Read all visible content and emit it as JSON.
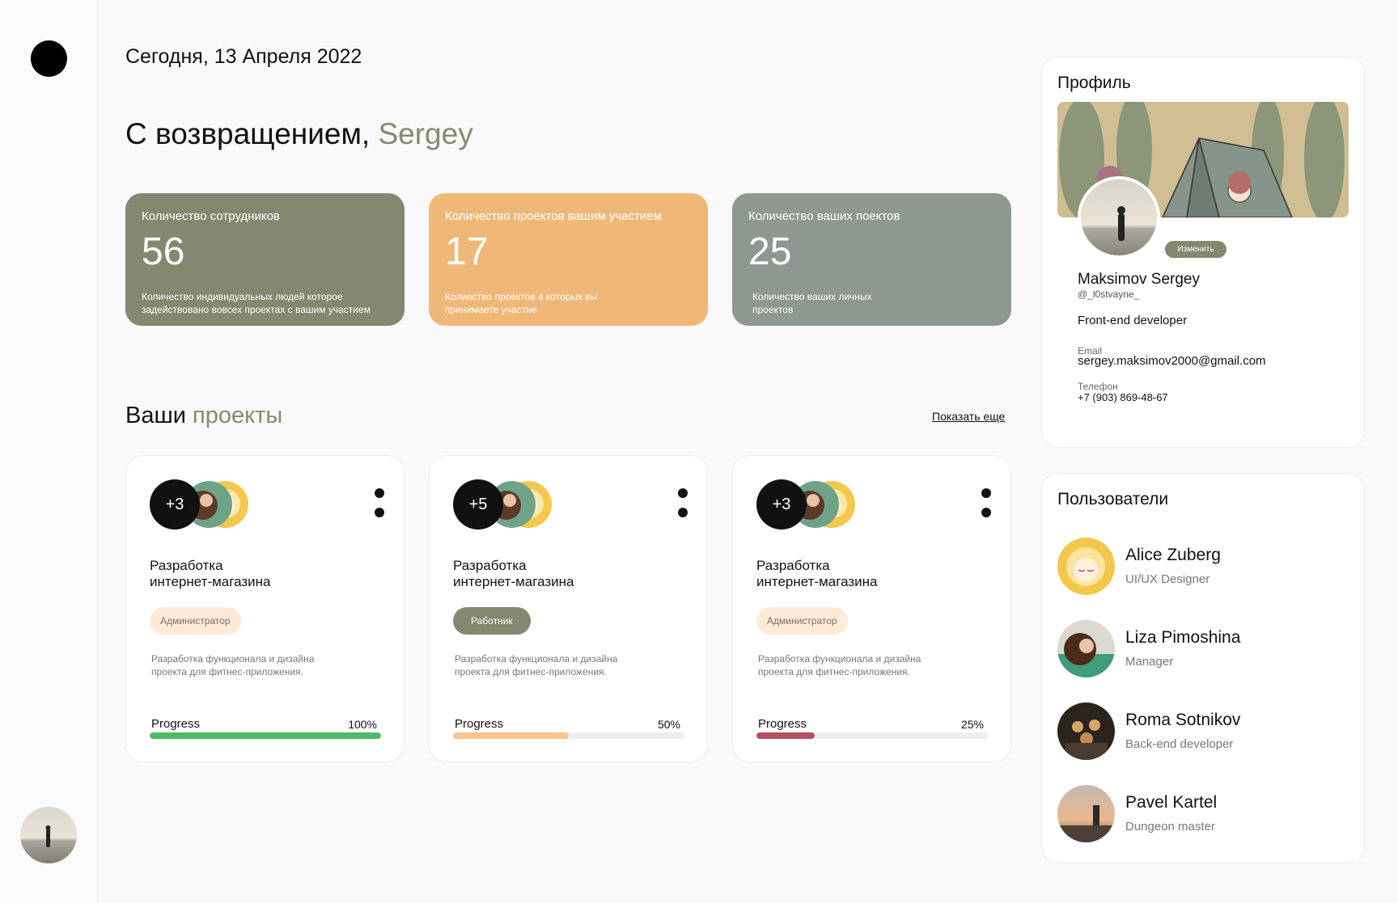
{
  "header": {
    "date": "Сегодня, 13 Апреля 2022",
    "welcome_prefix": "С возвращением,",
    "welcome_name": "Sergey"
  },
  "stats": [
    {
      "label": "Количество сотрудников",
      "value": "56",
      "desc": "Количество индивидуальных людей которое задействовано вовсех проектах с вашим участием",
      "color": "#858770"
    },
    {
      "label": "Количество проектов вашим участием",
      "value": "17",
      "desc": "Колиество проектов в которых вы принимаете участие",
      "color": "#f0b878"
    },
    {
      "label": "Количество ваших поектов",
      "value": "25",
      "desc": "Количество ваших личных проектов",
      "color": "#8e9790"
    }
  ],
  "projects_section": {
    "title_prefix": "Ваши",
    "title_highlight": "проекты",
    "show_more": "Показать еще"
  },
  "projects": [
    {
      "extra_members": "+3",
      "title": "Разработка интернет-магазина",
      "role": "Администратор",
      "role_type": "admin",
      "desc": "Разработка функционала и дизайна проекта для фитнес-приложения.",
      "progress_label": "Progress",
      "progress_text": "100%",
      "progress": 1.0,
      "color": "#4cbb68"
    },
    {
      "extra_members": "+5",
      "title": "Разработка интернет-магазина",
      "role": "Работник",
      "role_type": "worker",
      "desc": "Разработка функционала и дизайна проекта для фитнес-приложения.",
      "progress_label": "Progress",
      "progress_text": "50%",
      "progress": 0.5,
      "color": "#f7c48e"
    },
    {
      "extra_members": "+3",
      "title": "Разработка интернет-магазина",
      "role": "Администратор",
      "role_type": "admin",
      "desc": "Разработка функционала и дизайна проекта для фитнес-приложения.",
      "progress_label": "Progress",
      "progress_text": "25%",
      "progress": 0.25,
      "color": "#b54e60"
    }
  ],
  "profile": {
    "title": "Профиль",
    "edit_label": "Изменить",
    "name": "Maksimov Sergey",
    "handle": "@_l0stvayne_",
    "job": "Front-end developer",
    "email_label": "Email",
    "email": "sergey.maksimov2000@gmail.com",
    "phone_label": "Телефон",
    "phone": "+7 (903) 869-48-67"
  },
  "users": {
    "title": "Пользователи",
    "items": [
      {
        "name": "Alice Zuberg",
        "role": "UI/UX Designer"
      },
      {
        "name": "Liza Pimoshina",
        "role": "Manager"
      },
      {
        "name": "Roma Sotnikov",
        "role": "Back-end developer"
      },
      {
        "name": "Pavel Kartel",
        "role": "Dungeon master"
      }
    ]
  }
}
